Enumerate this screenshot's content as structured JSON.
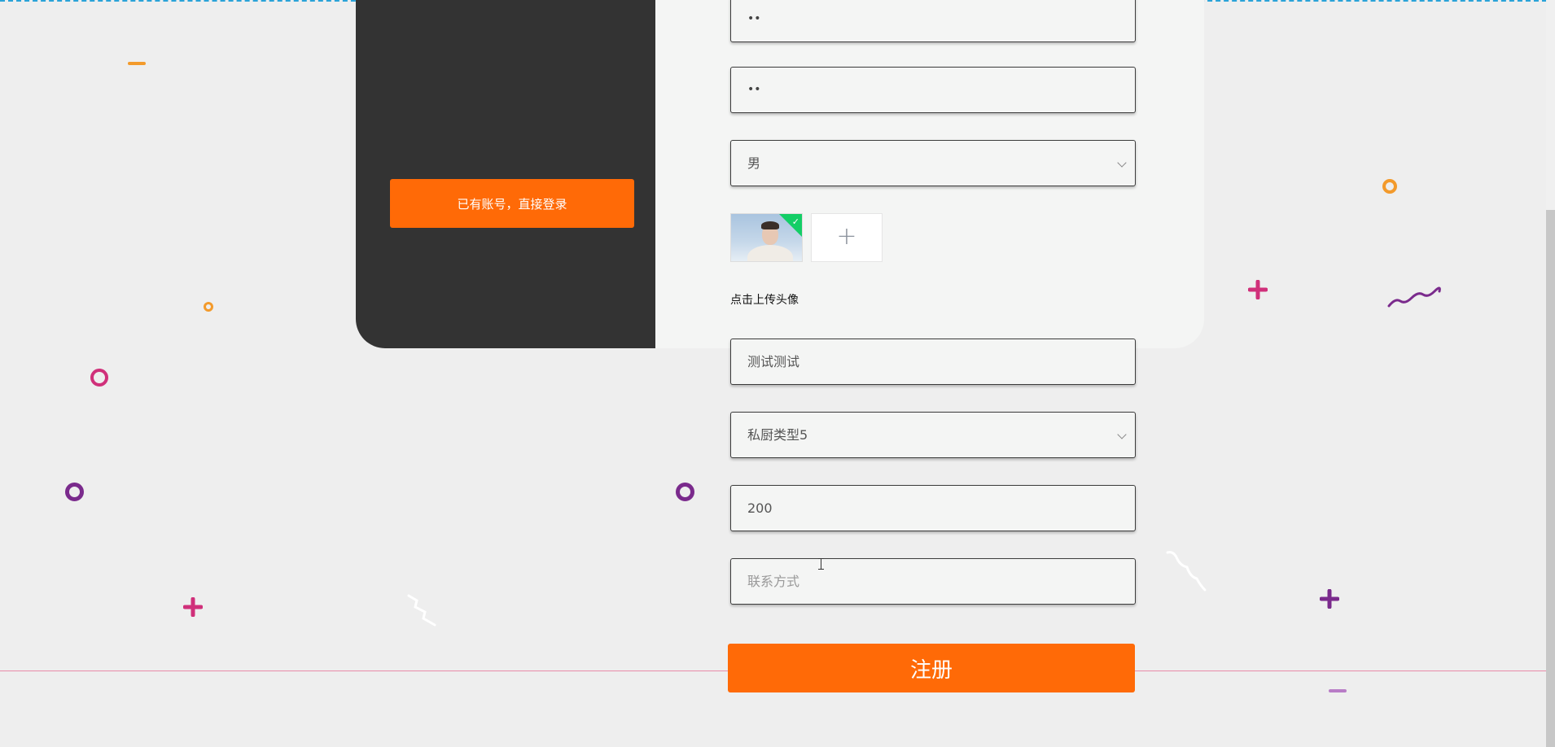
{
  "sidebar": {
    "login_button": "已有账号，直接登录"
  },
  "form": {
    "password": "••",
    "confirm_password": "••",
    "gender": "男",
    "upload_caption": "点击上传头像",
    "upload_plus": "+",
    "name": "测试测试",
    "kitchen_type": "私厨类型5",
    "price": "200",
    "contact_placeholder": "联系方式",
    "register_button": "注册"
  },
  "colors": {
    "accent": "#ff6a07",
    "sidebar_bg": "#333333",
    "page_bg": "#eeeeee",
    "orange": "#f39a2b",
    "magenta": "#d0307a",
    "purple": "#7a2a8c",
    "lavender": "#b87cc6"
  },
  "icons": {
    "upload_check": "check-icon",
    "select_arrow": "chevron-down-icon"
  }
}
